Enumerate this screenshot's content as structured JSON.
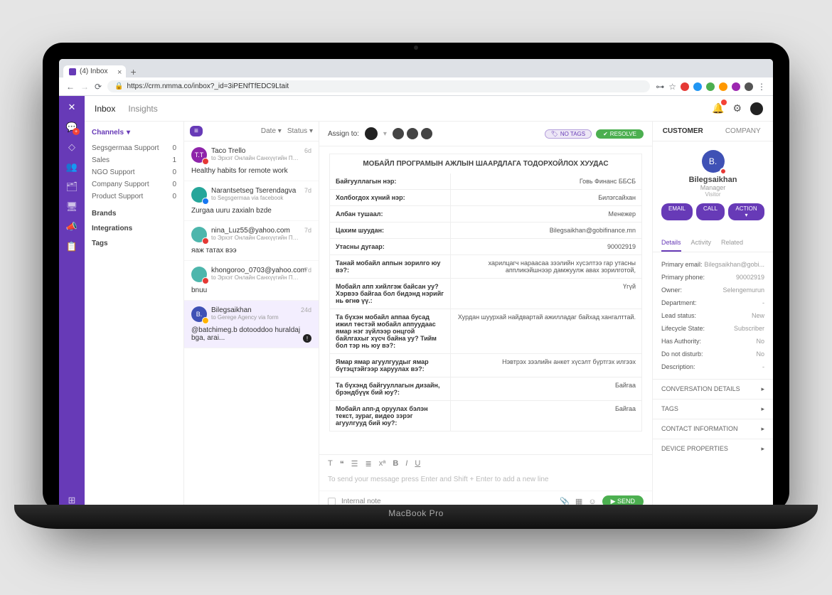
{
  "browser": {
    "tab_title": "(4) Inbox",
    "url": "https://crm.nmma.co/inbox?_id=3iPENfTfEDC9Ltait",
    "lock": "🔒"
  },
  "topbar": {
    "tabs": [
      "Inbox",
      "Insights"
    ]
  },
  "channels": {
    "heading": "Channels",
    "items": [
      {
        "label": "Segsgermaa Support",
        "count": "0"
      },
      {
        "label": "Sales",
        "count": "1"
      },
      {
        "label": "NGO Support",
        "count": "0"
      },
      {
        "label": "Company Support",
        "count": "0"
      },
      {
        "label": "Product Support",
        "count": "0"
      }
    ],
    "groups": [
      "Brands",
      "Integrations",
      "Tags"
    ]
  },
  "convo_head": {
    "date": "Date",
    "status": "Status"
  },
  "convos": [
    {
      "initials": "T.T",
      "bg": "#8e24aa",
      "name": "Taco Trello",
      "sub": "to Эрхэт Онлайн Санхүүгийн Програ...",
      "time": "6d",
      "snippet": "Healthy habits for remote work",
      "badge": "#e53935"
    },
    {
      "initials": "",
      "bg": "#26a69a",
      "name": "Narantsetseg Tserendagva",
      "sub": "to Segsgermaa via facebook",
      "time": "7d",
      "snippet": "Zurgaa uuru zaxialn bzde",
      "badge": "#1877f2",
      "img": true
    },
    {
      "initials": "",
      "bg": "#4db6ac",
      "name": "nina_Luz55@yahoo.com",
      "sub": "to Эрхэт Онлайн Санхүүгийн Програ...",
      "time": "7d",
      "snippet": "яаж татах вээ",
      "badge": "#e53935",
      "img": true
    },
    {
      "initials": "",
      "bg": "#4db6ac",
      "name": "khongoroo_0703@yahoo.com",
      "sub": "to Эрхэт Онлайн Санхүүгийн Програ...",
      "time": "7d",
      "snippet": "bnuu",
      "badge": "#e53935",
      "img": true
    },
    {
      "initials": "B.",
      "bg": "#3f51b5",
      "name": "Bilegsaikhan",
      "sub": "to Gerege Agency via form",
      "time": "24d",
      "snippet": "@batchimeg.b dotooddoo huraldaj bga, arai...",
      "badge": "#ffb300"
    }
  ],
  "assign": {
    "label": "Assign to:",
    "no_tags": "NO TAGS",
    "resolve": "RESOLVE"
  },
  "form": {
    "title": "МОБАЙЛ ПРОГРАМЫН АЖЛЫН ШААРДЛАГА ТОДОРХОЙЛОХ ХУУДАС",
    "rows": [
      {
        "label": "Байгууллагын нэр:",
        "value": "Говь Финанс ББСБ"
      },
      {
        "label": "Холбогдох хүний нэр:",
        "value": "Билэгсайхан"
      },
      {
        "label": "Албан тушаал:",
        "value": "Менежер"
      },
      {
        "label": "Цахим шуудан:",
        "value": "Bilegsaikhan@gobifinance.mn"
      },
      {
        "label": "Утасны дугаар:",
        "value": "90002919"
      },
      {
        "label": "Танай мобайл аппын зорилго юу вэ?:",
        "value": "харилцагч нараасаа зээлийн хүсэлтээ гар утасны аппликэйшнээр дамжуулж авах зорилготой,"
      },
      {
        "label": "Мобайл апп хийлгэж байсан уу? Хэрвээ байгаа бол бидэнд нэрийг нь өгнө үү.:",
        "value": "Үгүй"
      },
      {
        "label": "Та бүхэн мобайл аппаа бусад ижил төстэй мобайл аппуудаас ямар нэг зүйлээр онцгой байлгахыг хүсч байна уу? Тийм бол тэр нь юу вэ?:",
        "value": "Хурдан шуурхай найдвартай ажилладаг байхад хангалттай."
      },
      {
        "label": "Ямар ямар агуулгуудыг ямар бүтэцтэйгээр харуулах вэ?:",
        "value": "Нэвтрэх зээлийн анкет хүсэлт бүртгэх илгээх"
      },
      {
        "label": "Та бүхэнд байгууллагын дизайн, брэндбүүк бий юу?:",
        "value": "Байгаа"
      },
      {
        "label": "Мобайл апп-д оруулах бэлэн текст, зураг, видео зэрэг агуулгууд бий юу?:",
        "value": "Байгаа"
      }
    ]
  },
  "composer": {
    "placeholder": "To send your message press Enter and Shift + Enter to add a new line",
    "internal_note": "Internal note",
    "send": "SEND"
  },
  "right": {
    "tabs": [
      "CUSTOMER",
      "COMPANY"
    ],
    "name": "Bilegsaikhan",
    "role": "Manager",
    "visitor": "Visitor",
    "actions": [
      "EMAIL",
      "CALL",
      "ACTION ▾"
    ],
    "sub_tabs": [
      "Details",
      "Activity",
      "Related"
    ],
    "details": [
      {
        "k": "Primary email:",
        "v": "Bilegsaikhan@gobi..."
      },
      {
        "k": "Primary phone:",
        "v": "90002919"
      },
      {
        "k": "Owner:",
        "v": "Selengemurun"
      },
      {
        "k": "Department:",
        "v": "-"
      },
      {
        "k": "Lead status:",
        "v": "New"
      },
      {
        "k": "Lifecycle State:",
        "v": "Subscriber"
      },
      {
        "k": "Has Authority:",
        "v": "No"
      },
      {
        "k": "Do not disturb:",
        "v": "No"
      },
      {
        "k": "Description:",
        "v": "-"
      }
    ],
    "accordions": [
      "CONVERSATION DETAILS",
      "TAGS",
      "CONTACT INFORMATION",
      "DEVICE PROPERTIES"
    ]
  }
}
